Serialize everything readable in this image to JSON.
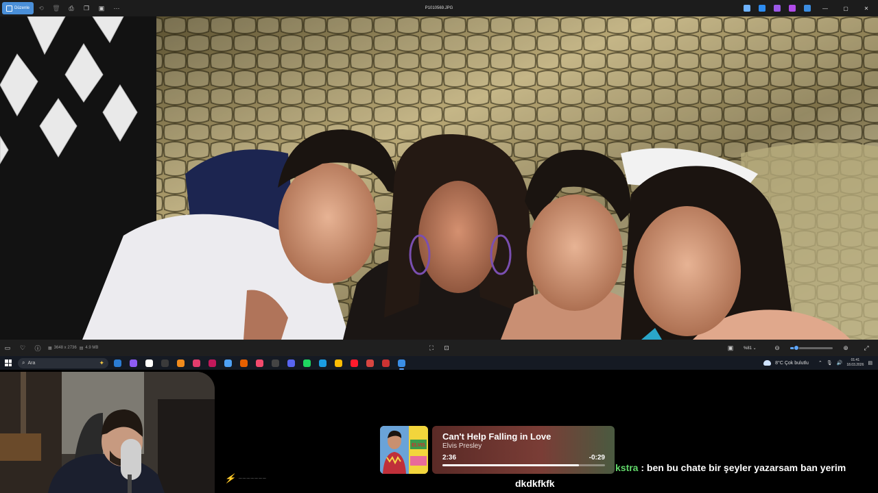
{
  "titlebar": {
    "edit_label": "Düzenle",
    "file_name": "P1010569.JPG",
    "left_icons": [
      "rotate-icon",
      "delete-icon",
      "print-icon",
      "copy-icon",
      "slideshow-icon",
      "more-icon"
    ],
    "right_apps": [
      "copilot-icon",
      "photos-edit-icon",
      "clipchamp-icon",
      "designer-icon",
      "onedrive-icon"
    ],
    "window_controls": [
      "minimize-icon",
      "maximize-icon",
      "close-icon"
    ]
  },
  "infobar": {
    "dimensions": "3648 x 2736",
    "file_size": "4.9 MB",
    "zoom": "%81",
    "zoom_fraction": 0.15
  },
  "taskbar": {
    "search_placeholder": "Ara",
    "apps": [
      {
        "name": "outlook",
        "color": "#2b7cd3"
      },
      {
        "name": "copilot",
        "color": "#8e5cf5"
      },
      {
        "name": "store",
        "color": "#ffffff"
      },
      {
        "name": "terminal",
        "color": "#3a3a3a"
      },
      {
        "name": "vlc",
        "color": "#f08a1c"
      },
      {
        "name": "media",
        "color": "#e23c6c"
      },
      {
        "name": "app-red",
        "color": "#c2185b"
      },
      {
        "name": "podcast",
        "color": "#4ea1f5"
      },
      {
        "name": "firefox",
        "color": "#e66000"
      },
      {
        "name": "music",
        "color": "#f24a6d"
      },
      {
        "name": "tv",
        "color": "#444444"
      },
      {
        "name": "discord",
        "color": "#5865f2"
      },
      {
        "name": "spotify",
        "color": "#1ed760"
      },
      {
        "name": "edge",
        "color": "#1b9de2"
      },
      {
        "name": "chrome",
        "color": "#fbbc04"
      },
      {
        "name": "opera",
        "color": "#ff1b2d"
      },
      {
        "name": "recorder",
        "color": "#d64541"
      },
      {
        "name": "obs",
        "color": "#cc3333"
      },
      {
        "name": "photos",
        "color": "#3a8ee6"
      }
    ],
    "weather": "8°C  Çok bulutlu",
    "time": "01:41",
    "date": "18.03.2026"
  },
  "now_playing": {
    "title": "Can't Help Falling in Love",
    "artist": "Elvis Presley",
    "elapsed": "2:36",
    "remaining": "-0:29",
    "progress_fraction": 0.84,
    "album_text": "ELVIS"
  },
  "chat": {
    "user": "kstra",
    "message": " : ben bu chate bir şeyler yazarsam ban yerim",
    "line2": "dkdkfkfk"
  }
}
